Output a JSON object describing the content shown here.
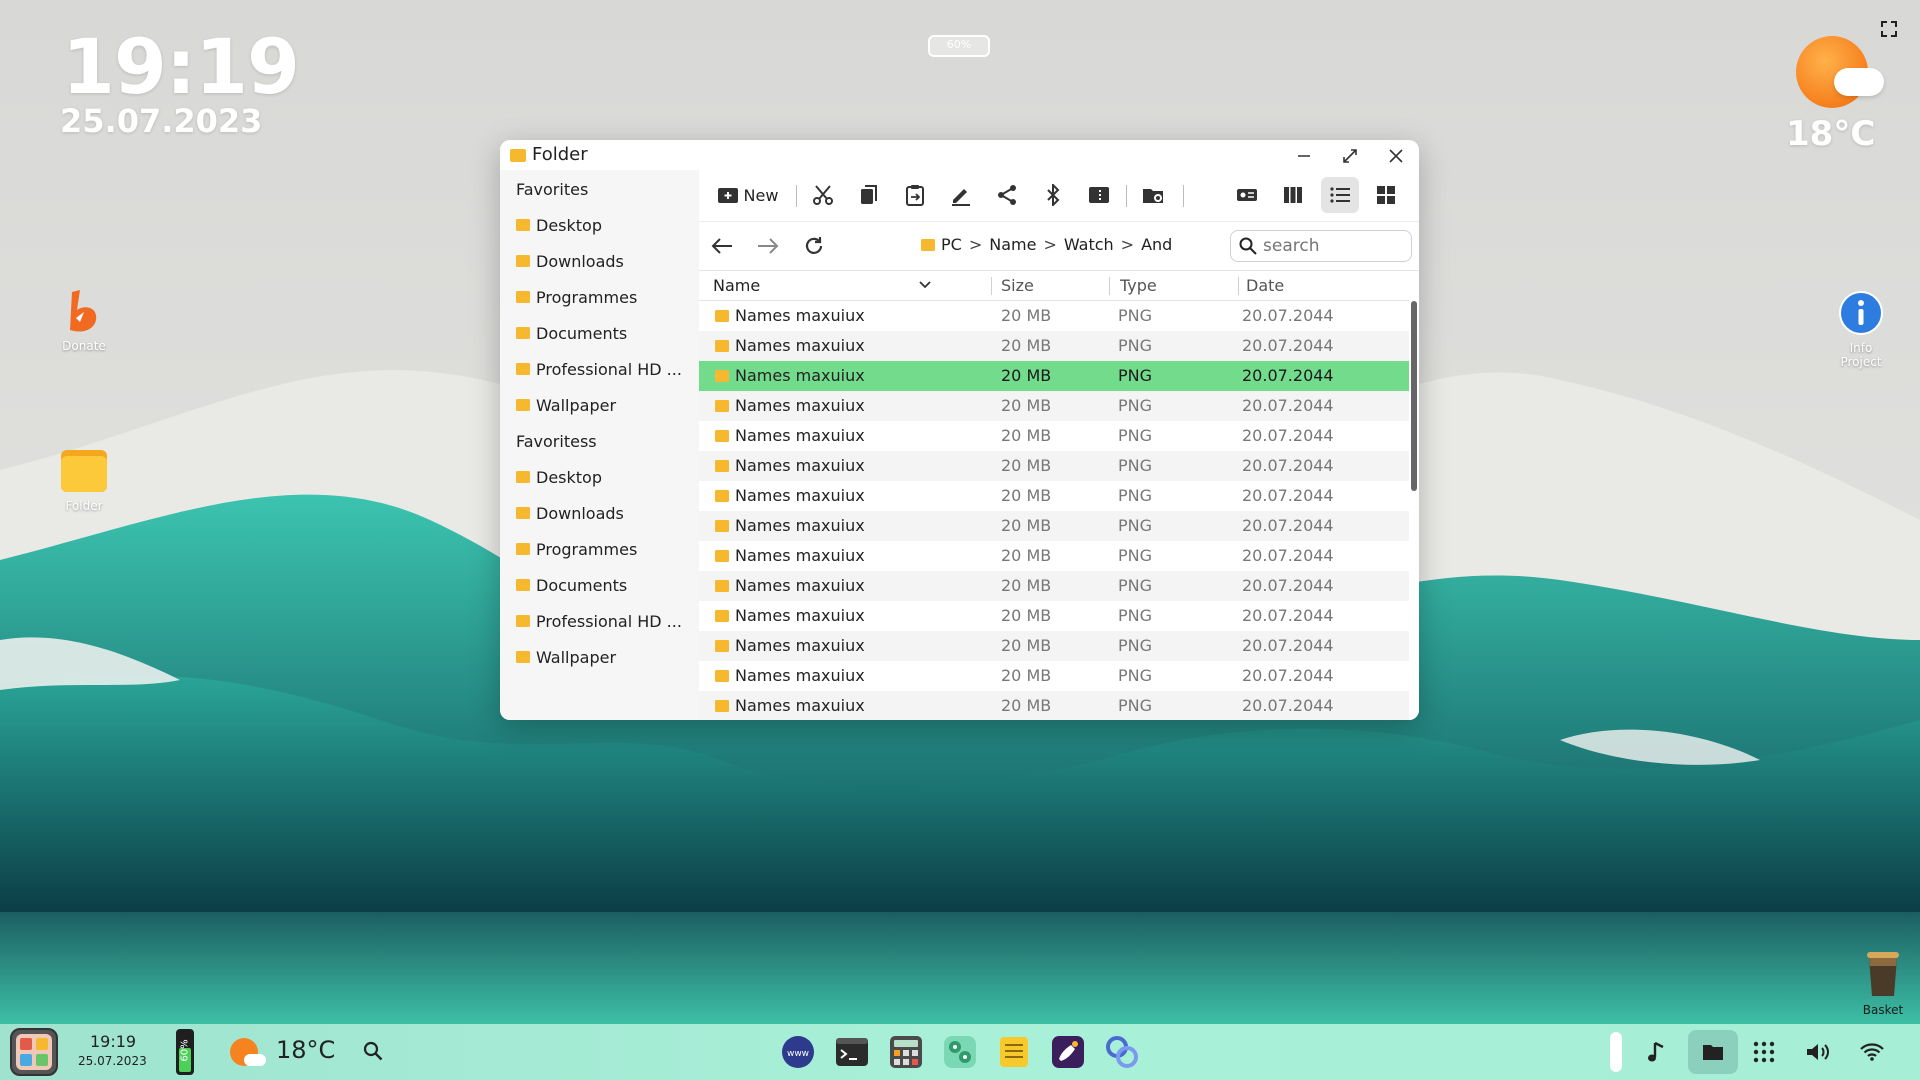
{
  "desktop": {
    "clock": {
      "time": "19:19",
      "date": "25.07.2023"
    },
    "battery_top": "60%",
    "weather": {
      "temp": "18°C"
    },
    "icons": {
      "donate": "Donate",
      "folder": "Folder",
      "info": "Info Project",
      "basket": "Basket"
    }
  },
  "window": {
    "title": "Folder",
    "sidebar": {
      "group1": {
        "title": "Favorites",
        "items": [
          "Desktop",
          "Downloads",
          "Programmes",
          "Documents",
          "Professional HD ...",
          "Wallpaper"
        ]
      },
      "group2": {
        "title": "Favoritess",
        "items": [
          "Desktop",
          "Downloads",
          "Programmes",
          "Documents",
          "Professional HD ...",
          "Wallpaper"
        ]
      }
    },
    "toolbar": {
      "new_label": "New"
    },
    "breadcrumb": [
      "PC",
      "Name",
      "Watch",
      "And"
    ],
    "search": {
      "placeholder": "search"
    },
    "columns": {
      "name": "Name",
      "size": "Size",
      "type": "Type",
      "date": "Date"
    },
    "rows": [
      {
        "name": "Names maxuiux",
        "size": "20 MB",
        "type": "PNG",
        "date": "20.07.2044"
      },
      {
        "name": "Names maxuiux",
        "size": "20 MB",
        "type": "PNG",
        "date": "20.07.2044"
      },
      {
        "name": "Names maxuiux",
        "size": "20 MB",
        "type": "PNG",
        "date": "20.07.2044",
        "selected": true
      },
      {
        "name": "Names maxuiux",
        "size": "20 MB",
        "type": "PNG",
        "date": "20.07.2044"
      },
      {
        "name": "Names maxuiux",
        "size": "20 MB",
        "type": "PNG",
        "date": "20.07.2044"
      },
      {
        "name": "Names maxuiux",
        "size": "20 MB",
        "type": "PNG",
        "date": "20.07.2044"
      },
      {
        "name": "Names maxuiux",
        "size": "20 MB",
        "type": "PNG",
        "date": "20.07.2044"
      },
      {
        "name": "Names maxuiux",
        "size": "20 MB",
        "type": "PNG",
        "date": "20.07.2044"
      },
      {
        "name": "Names maxuiux",
        "size": "20 MB",
        "type": "PNG",
        "date": "20.07.2044"
      },
      {
        "name": "Names maxuiux",
        "size": "20 MB",
        "type": "PNG",
        "date": "20.07.2044"
      },
      {
        "name": "Names maxuiux",
        "size": "20 MB",
        "type": "PNG",
        "date": "20.07.2044"
      },
      {
        "name": "Names maxuiux",
        "size": "20 MB",
        "type": "PNG",
        "date": "20.07.2044"
      },
      {
        "name": "Names maxuiux",
        "size": "20 MB",
        "type": "PNG",
        "date": "20.07.2044"
      },
      {
        "name": "Names maxuiux",
        "size": "20 MB",
        "type": "PNG",
        "date": "20.07.2044"
      }
    ]
  },
  "taskbar": {
    "time": "19:19",
    "date": "25.07.2023",
    "battery": "60%",
    "temp": "18°C",
    "apps": [
      "browser-icon",
      "terminal-icon",
      "calculator-icon",
      "settings-app-icon",
      "notes-icon",
      "paint-icon",
      "store-icon"
    ]
  },
  "colors": {
    "selected_row": "#73dc8c",
    "folder_yellow": "#f5b82e",
    "taskbar": "#a6eed6"
  }
}
